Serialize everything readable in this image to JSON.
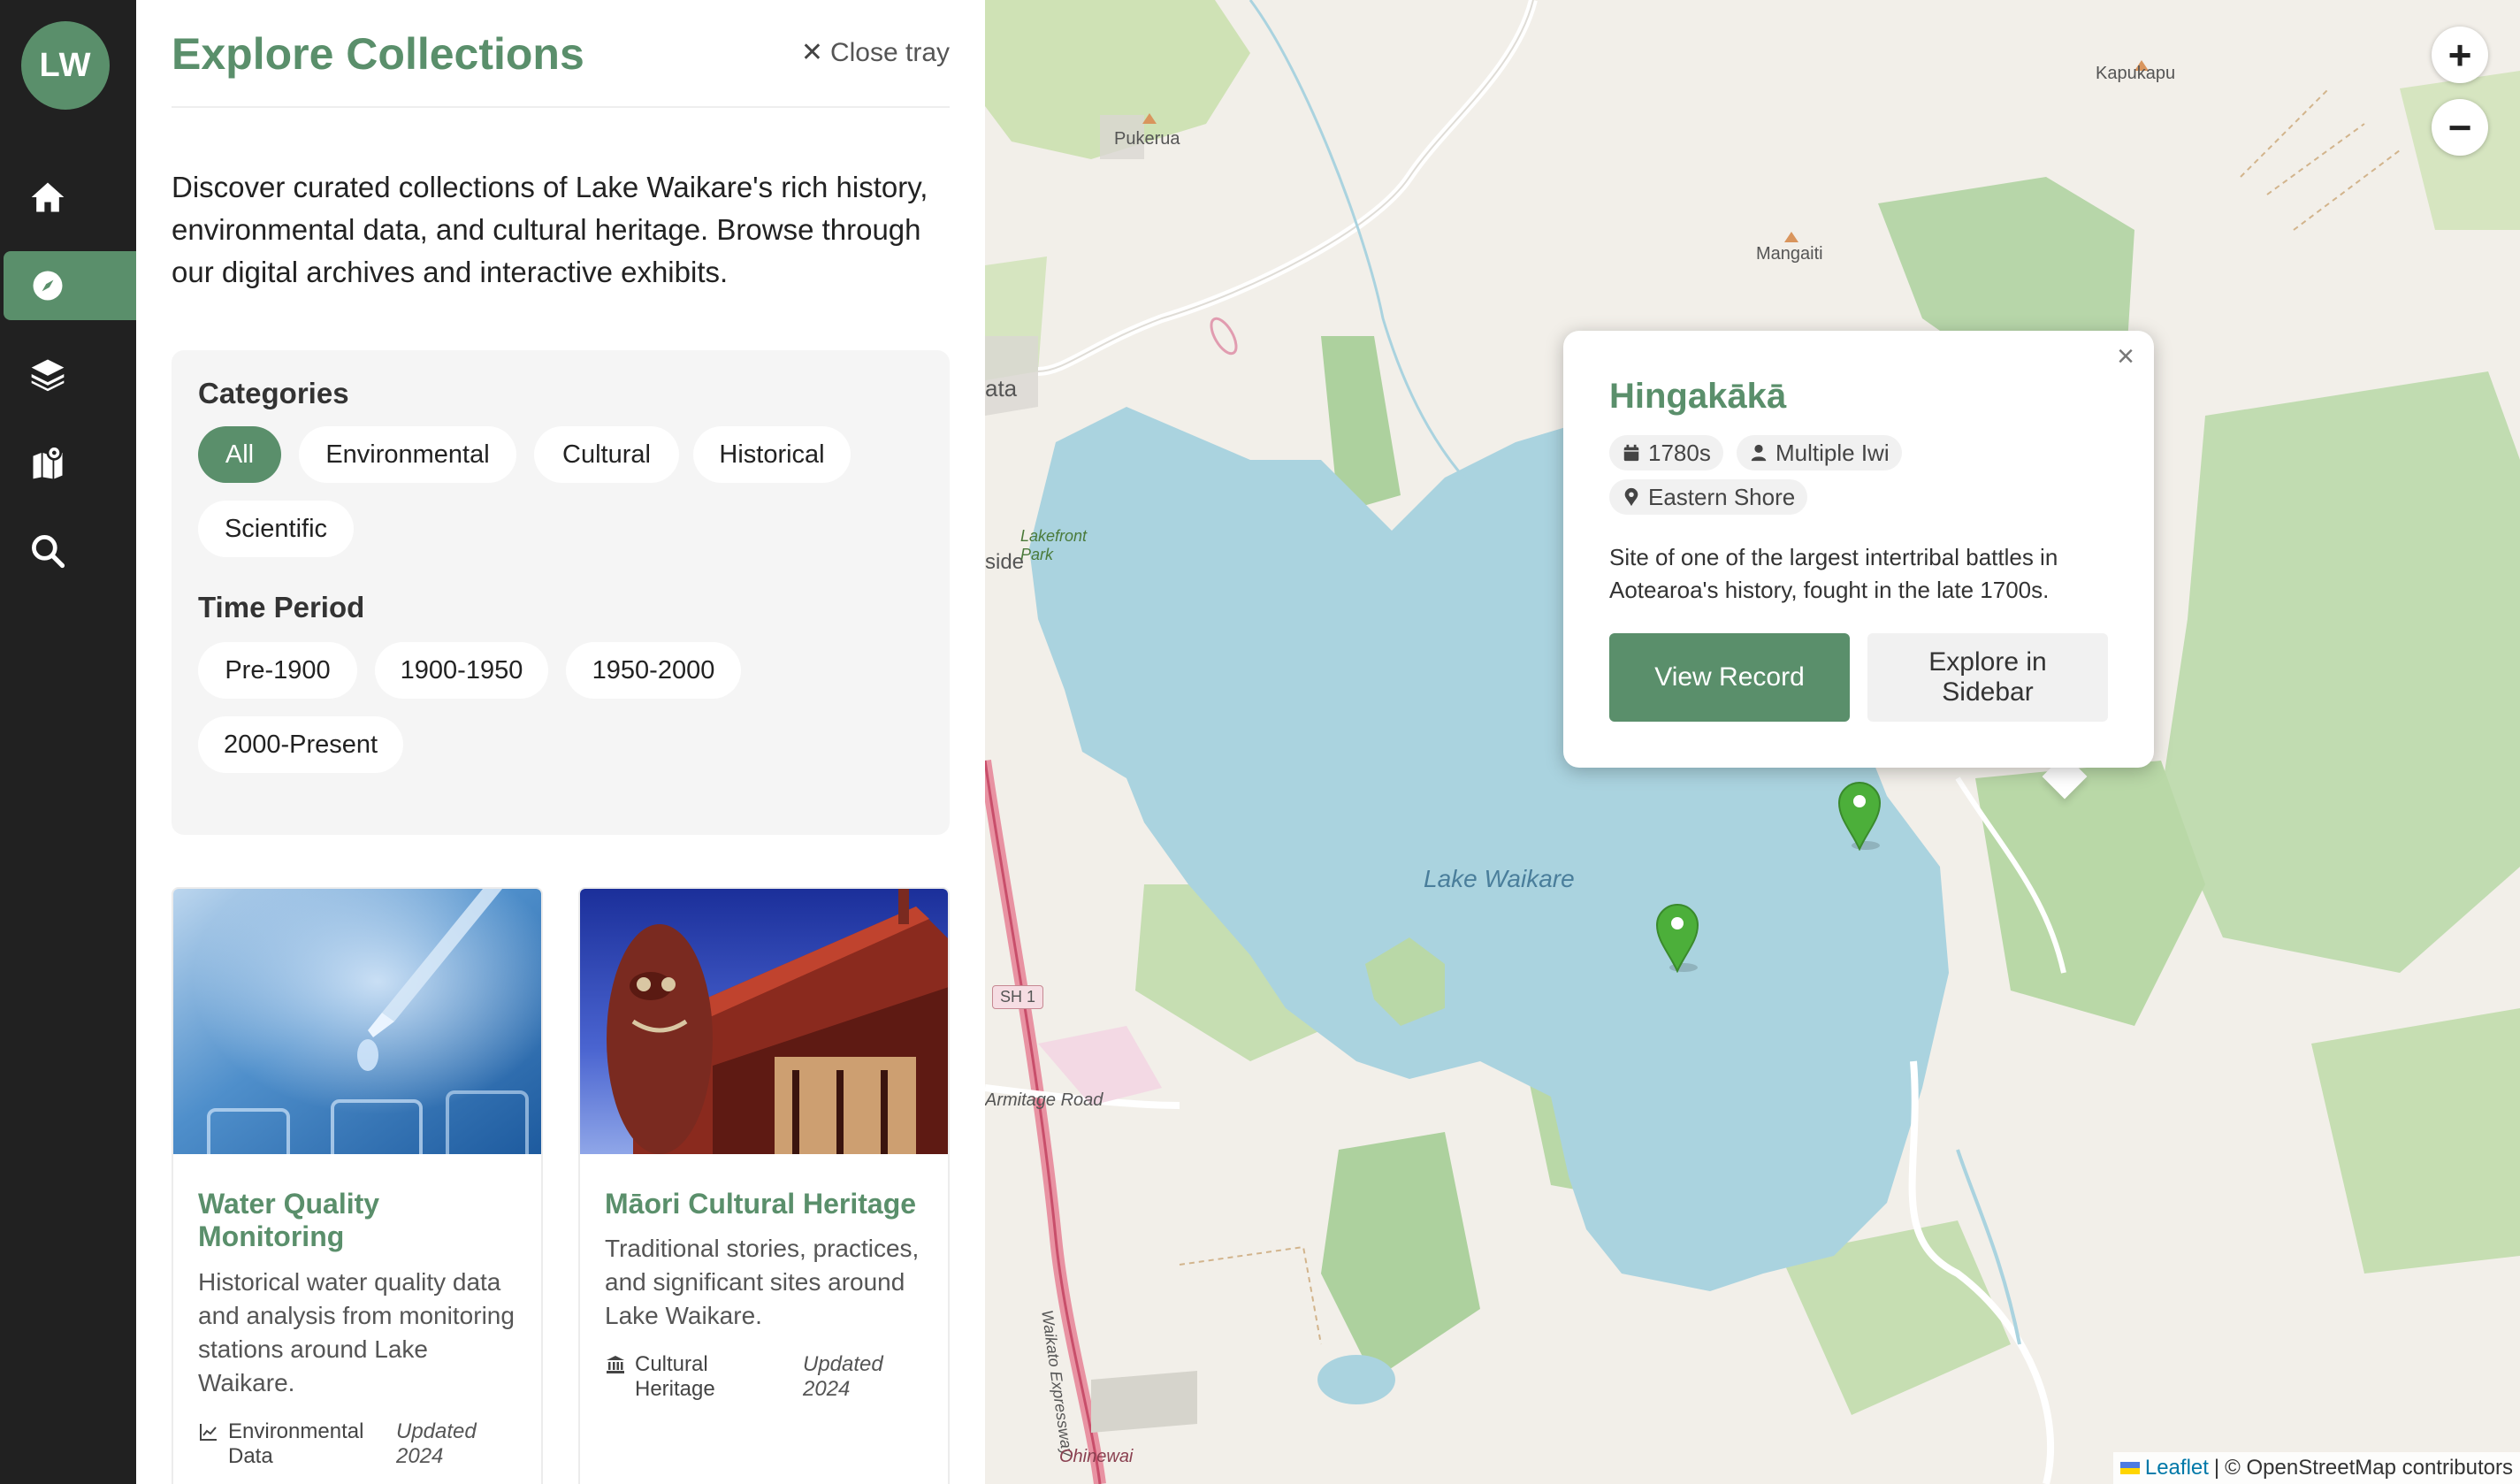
{
  "app": {
    "initials": "LW"
  },
  "rail": {
    "items": [
      {
        "name": "home",
        "icon": "home-icon",
        "active": false
      },
      {
        "name": "explore",
        "icon": "compass-icon",
        "active": true
      },
      {
        "name": "layers",
        "icon": "layers-icon",
        "active": false
      },
      {
        "name": "map",
        "icon": "map-marked-icon",
        "active": false
      },
      {
        "name": "search",
        "icon": "search-icon",
        "active": false
      }
    ]
  },
  "tray": {
    "title": "Explore Collections",
    "close_label": "Close tray",
    "intro": "Discover curated collections of Lake Waikare's rich history, environmental data, and cultural heritage. Browse through our digital archives and interactive exhibits.",
    "categories_heading": "Categories",
    "categories": [
      "All",
      "Environmental",
      "Cultural",
      "Historical",
      "Scientific"
    ],
    "selected_category": "All",
    "time_heading": "Time Period",
    "time_periods": [
      "Pre-1900",
      "1900-1950",
      "1950-2000",
      "2000-Present"
    ],
    "cards": [
      {
        "title": "Water Quality Monitoring",
        "description": "Historical water quality data and analysis from monitoring stations around Lake Waikare.",
        "tag": "Environmental Data",
        "tag_icon": "chart-line-icon",
        "updated": "Updated 2024"
      },
      {
        "title": "Māori Cultural Heritage",
        "description": "Traditional stories, practices, and significant sites around Lake Waikare.",
        "tag": "Cultural Heritage",
        "tag_icon": "landmark-icon",
        "updated": "Updated 2024"
      }
    ]
  },
  "map": {
    "zoom_in": "+",
    "zoom_out": "−",
    "labels": {
      "lake": "Lake Waikare",
      "pukerua": "Pukerua",
      "mangaiti": "Mangaiti",
      "kapukapu": "Kapukapu",
      "lakefront_park": "Lakefront Park",
      "armitage_road": "Armitage Road",
      "waikato_expressway": "Waikato Expressway",
      "ohinewai": "Ohinewai",
      "sh1": "SH 1",
      "ata": "ata",
      "side": "side"
    },
    "attribution": {
      "leaflet": "Leaflet",
      "separator": "|",
      "osm": "© OpenStreetMap contributors"
    },
    "colors": {
      "water": "#aad3df",
      "park": "#add19e",
      "land": "#f2efe9",
      "accent": "#5a8f6b"
    }
  },
  "popup": {
    "title": "Hingakākā",
    "date": "1780s",
    "people": "Multiple Iwi",
    "location": "Eastern Shore",
    "description": "Site of one of the largest intertribal battles in Aotearoa's history, fought in the late 1700s.",
    "view_record": "View Record",
    "explore_sidebar": "Explore in Sidebar"
  }
}
